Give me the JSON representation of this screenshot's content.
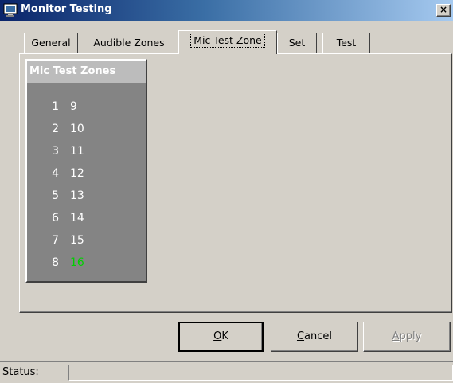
{
  "window": {
    "title": "Monitor Testing",
    "close_label": "×",
    "icon": "monitor-icon"
  },
  "tabs": [
    {
      "label": "General",
      "active": false
    },
    {
      "label": "Audible Zones",
      "active": false
    },
    {
      "label": "Mic Test Zone",
      "active": true
    },
    {
      "label": "Set",
      "active": false
    },
    {
      "label": "Test",
      "active": false
    }
  ],
  "mic_panel": {
    "title": "Mic Test Zones",
    "rows": [
      {
        "a": "1",
        "b": "9"
      },
      {
        "a": "2",
        "b": "10"
      },
      {
        "a": "3",
        "b": "11"
      },
      {
        "a": "4",
        "b": "12"
      },
      {
        "a": "5",
        "b": "13"
      },
      {
        "a": "6",
        "b": "14"
      },
      {
        "a": "7",
        "b": "15"
      },
      {
        "a": "8",
        "b": "16"
      }
    ],
    "highlight_zone": "16",
    "highlight_color": "#00d000",
    "zone_color": "#ffffff"
  },
  "buttons": {
    "ok": {
      "label": "OK",
      "mnemonic": "O",
      "rest": "K"
    },
    "cancel": {
      "label": "Cancel",
      "mnemonic": "C",
      "rest": "ancel"
    },
    "apply": {
      "label": "Apply",
      "mnemonic": "A",
      "rest": "pply",
      "disabled": true
    }
  },
  "status": {
    "label": "Status:",
    "value": ""
  },
  "colors": {
    "dialog_bg": "#d4d0c8",
    "panel_bg": "#848484",
    "title_gradient_start": "#0a246a",
    "title_gradient_end": "#a6caf0"
  }
}
